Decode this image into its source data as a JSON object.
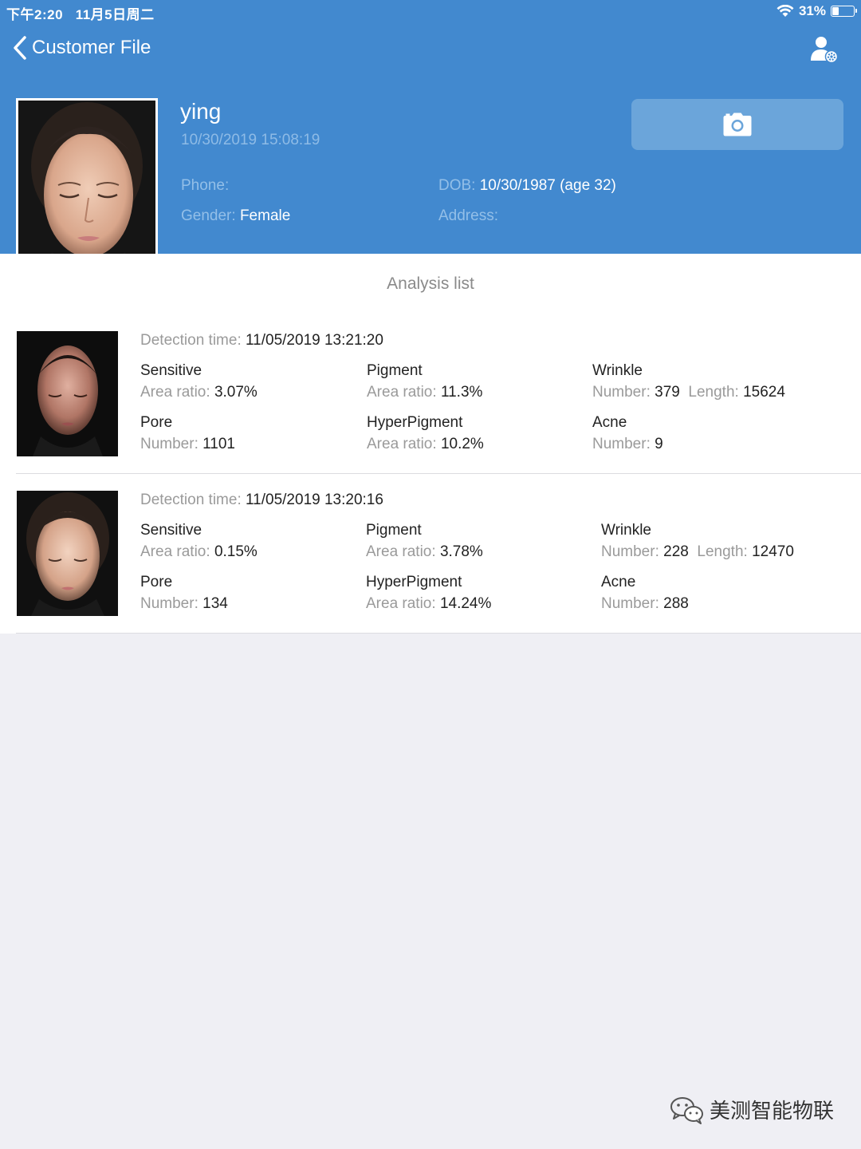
{
  "status_bar": {
    "time": "下午2:20",
    "date": "11月5日周二",
    "battery": "31%",
    "battery_level": 0.31
  },
  "nav": {
    "back_label": "Customer File",
    "icons": {
      "back": "chevron-left-icon",
      "settings": "user-settings-icon"
    }
  },
  "profile": {
    "name": "ying",
    "created": "10/30/2019 15:08:19",
    "phone_label": "Phone:",
    "phone_value": "",
    "dob_label": "DOB:",
    "dob_value": "10/30/1987 (age 32)",
    "gender_label": "Gender:",
    "gender_value": "Female",
    "address_label": "Address:",
    "address_value": ""
  },
  "camera_icon": "camera-icon",
  "analysis_list": {
    "title": "Analysis list",
    "items": [
      {
        "detection_label": "Detection time:",
        "detection_time": "11/05/2019 13:21:20",
        "sensitive": {
          "name": "Sensitive",
          "label": "Area ratio:",
          "value": "3.07%"
        },
        "pigment": {
          "name": "Pigment",
          "label": "Area ratio:",
          "value": "11.3%"
        },
        "wrinkle": {
          "name": "Wrinkle",
          "number_label": "Number:",
          "number": "379",
          "length_label": "Length:",
          "length": "15624"
        },
        "pore": {
          "name": "Pore",
          "label": "Number:",
          "value": "1101"
        },
        "hyperpigment": {
          "name": "HyperPigment",
          "label": "Area ratio:",
          "value": "10.2%"
        },
        "acne": {
          "name": "Acne",
          "label": "Number:",
          "value": "9"
        }
      },
      {
        "detection_label": "Detection time:",
        "detection_time": "11/05/2019 13:20:16",
        "sensitive": {
          "name": "Sensitive",
          "label": "Area ratio:",
          "value": "0.15%"
        },
        "pigment": {
          "name": "Pigment",
          "label": "Area ratio:",
          "value": "3.78%"
        },
        "wrinkle": {
          "name": "Wrinkle",
          "number_label": "Number:",
          "number": "228",
          "length_label": "Length:",
          "length": "12470"
        },
        "pore": {
          "name": "Pore",
          "label": "Number:",
          "value": "134"
        },
        "hyperpigment": {
          "name": "HyperPigment",
          "label": "Area ratio:",
          "value": "14.24%"
        },
        "acne": {
          "name": "Acne",
          "label": "Number:",
          "value": "288"
        }
      }
    ]
  },
  "watermark": {
    "text": "美测智能物联",
    "icon": "wechat-icon"
  },
  "colors": {
    "header_blue": "#4289cf",
    "camera_button": "#6ba5da",
    "background": "#efeff4"
  }
}
